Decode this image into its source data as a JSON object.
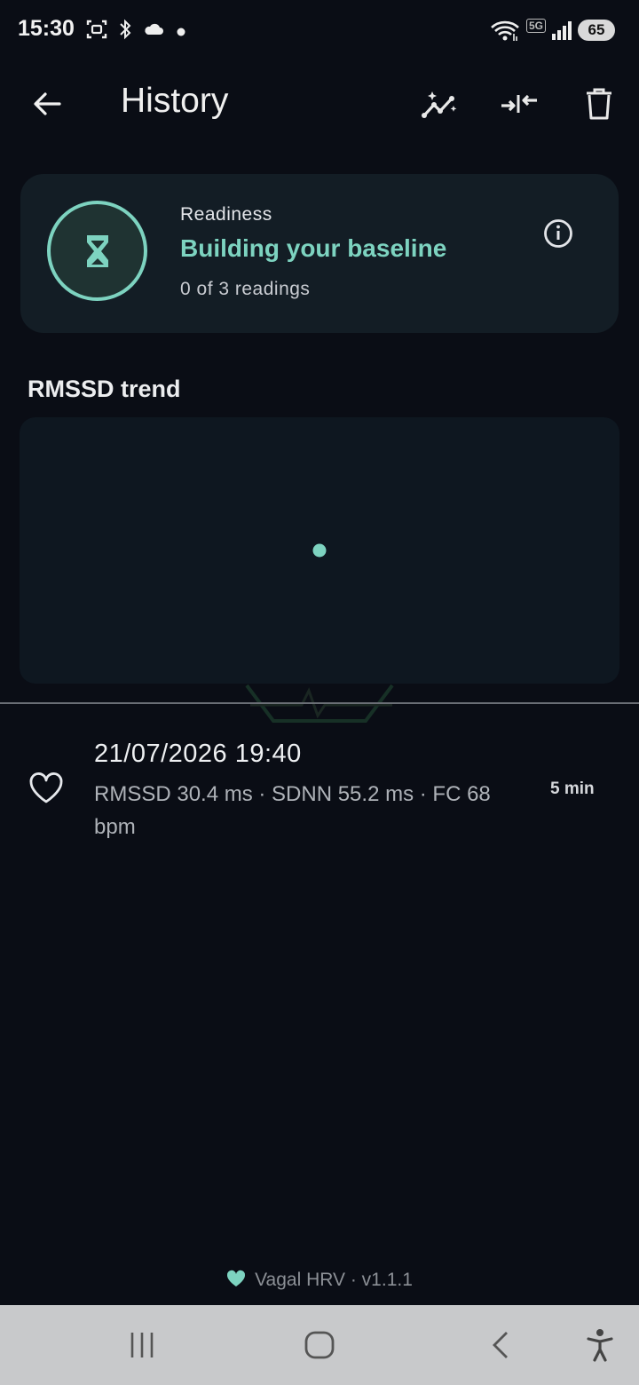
{
  "status_bar": {
    "time": "15:30",
    "network": "5G",
    "battery": "65",
    "icons": [
      "screenshot-icon",
      "bluetooth-icon",
      "cloud-icon",
      "dot-icon",
      "wifi-icon",
      "signal-icon"
    ]
  },
  "app_bar": {
    "title": "History",
    "actions": [
      "back-arrow-icon",
      "trend-sparkle-icon",
      "compare-icon",
      "delete-icon"
    ]
  },
  "readiness": {
    "label": "Readiness",
    "title": "Building your baseline",
    "subtitle": "0 of 3 readings",
    "icon": "hourglass-icon",
    "info_icon": "info-icon"
  },
  "trend": {
    "title": "RMSSD trend"
  },
  "chart_data": {
    "type": "scatter",
    "x": [
      "21/07/2026 19:40"
    ],
    "values": [
      30.4
    ],
    "grid": false,
    "point_color": "#7dd3c0"
  },
  "sessions": [
    {
      "date": "21/07/2026 19:40",
      "detail": "RMSSD 30.4 ms · SDNN 55.2 ms · FC 68 bpm",
      "duration": "5 min",
      "icon": "heart-outline-icon"
    }
  ],
  "footer": {
    "text": "Vagal HRV · v1.1.1",
    "icon": "heart-icon"
  },
  "colors": {
    "accent": "#7dd3c0",
    "background": "#0a0d15",
    "card": "#131d25"
  }
}
